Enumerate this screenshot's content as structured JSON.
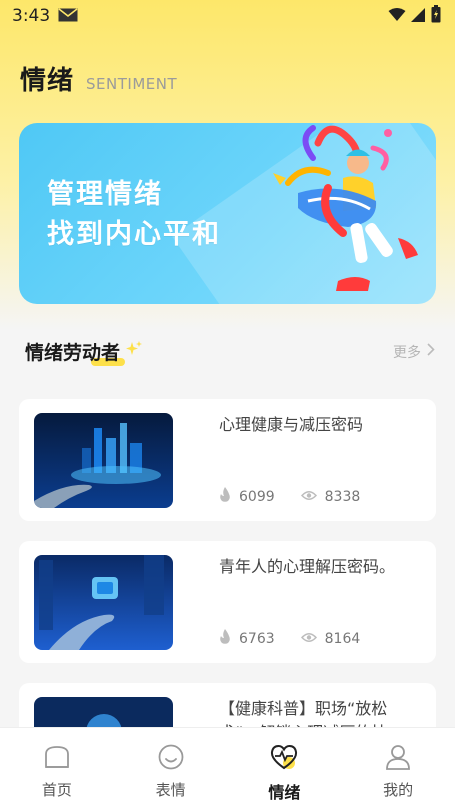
{
  "status_bar": {
    "time": "3:43"
  },
  "header": {
    "title": "情绪",
    "subtitle": "SENTIMENT"
  },
  "banner": {
    "line1": "管理情绪",
    "line2": "找到内心平和"
  },
  "section": {
    "title": "情绪劳动者",
    "more": "更多"
  },
  "articles": [
    {
      "title": "心理健康与减压密码",
      "likes": "6099",
      "views": "8338"
    },
    {
      "title": "青年人的心理解压密码。",
      "likes": "6763",
      "views": "8164"
    },
    {
      "title": "【健康科普】职场“放松术”：解锁心理减压的技",
      "likes": "",
      "views": ""
    }
  ],
  "tabbar": {
    "items": [
      {
        "label": "首页",
        "icon": "home-icon"
      },
      {
        "label": "表情",
        "icon": "smile-icon"
      },
      {
        "label": "情绪",
        "icon": "heart-pulse-icon",
        "active": true
      },
      {
        "label": "我的",
        "icon": "user-icon"
      }
    ]
  },
  "colors": {
    "accent_yellow": "#fde04a",
    "banner_blue": "#5ccdf7"
  }
}
